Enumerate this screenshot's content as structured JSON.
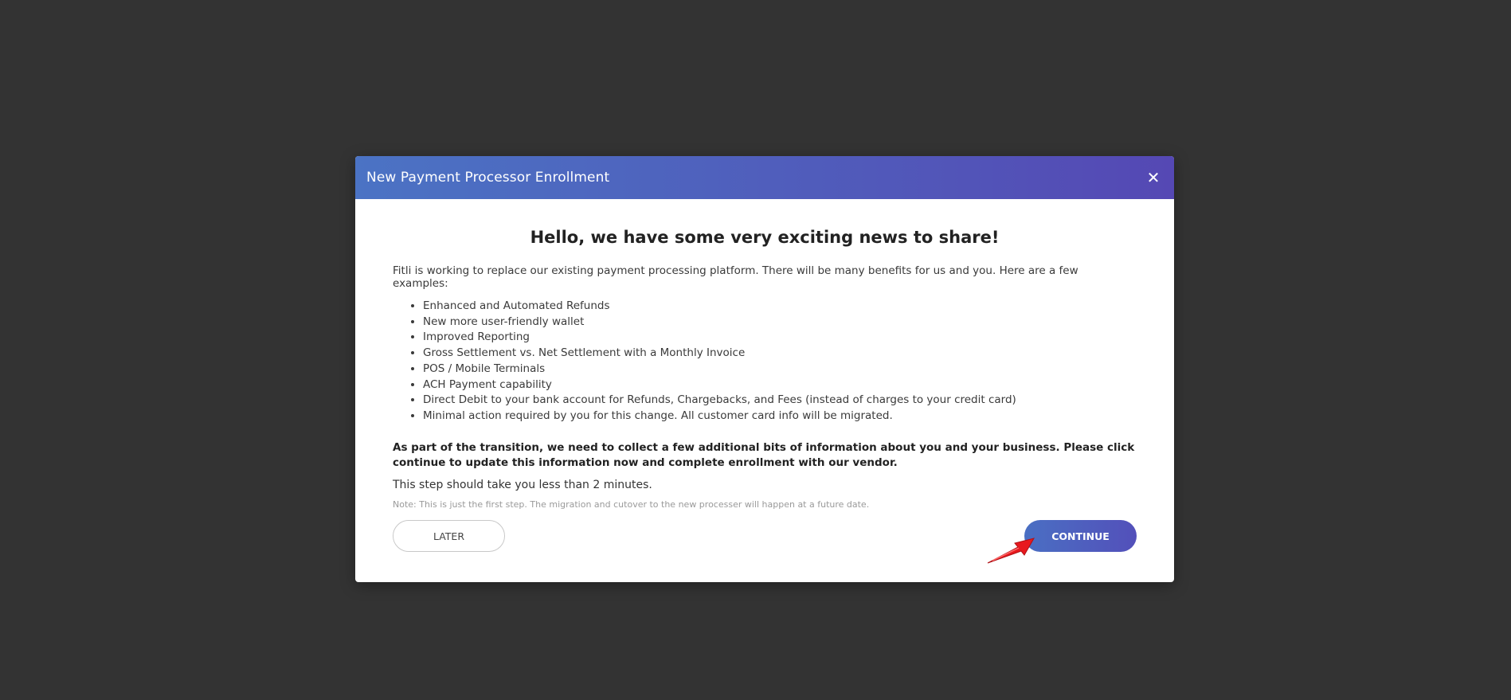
{
  "modal": {
    "title": "New Payment Processor Enrollment",
    "close_icon": "close-icon",
    "headline": "Hello, we have some very exciting news to share!",
    "intro": "Fitli is working to replace our existing payment processing platform. There will be many benefits for us and you. Here are a few examples:",
    "benefits": [
      "Enhanced and Automated Refunds",
      "New more user-friendly wallet",
      "Improved Reporting",
      "Gross Settlement vs. Net Settlement with a Monthly Invoice",
      "POS / Mobile Terminals",
      "ACH Payment capability",
      "Direct Debit to your bank account for Refunds, Chargebacks, and Fees (instead of charges to your credit card)",
      "Minimal action required by you for this change. All customer card info will be migrated."
    ],
    "transition_text": "As part of the transition, we need to collect a few additional bits of information about you and your business. Please click continue to update this information now and complete enrollment with our vendor.",
    "step_text": "This step should take you less than 2 minutes.",
    "note_text": "Note: This is just the first step. The migration and cutover to the new processer will happen at a future date.",
    "later_label": "LATER",
    "continue_label": "CONTINUE"
  },
  "colors": {
    "overlay": "#333333",
    "header_start": "#4b73c4",
    "header_end": "#5548b4",
    "continue_button": "#4f5fbe",
    "annotation_arrow": "#e8191e"
  },
  "annotation": {
    "icon": "red-arrow-icon"
  }
}
